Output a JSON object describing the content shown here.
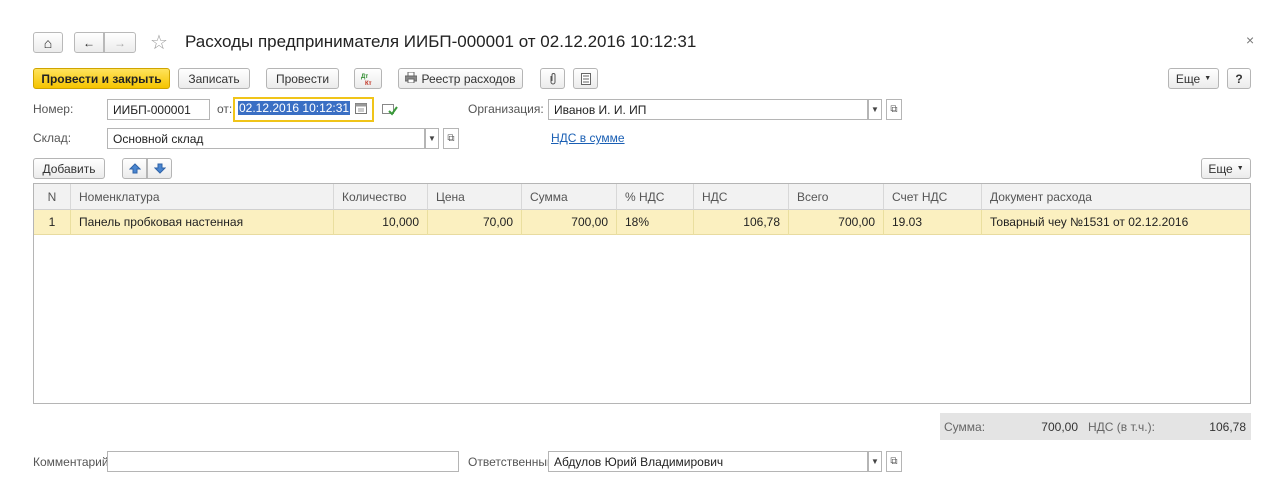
{
  "window": {
    "title": "Расходы предпринимателя ИИБП-000001 от 02.12.2016 10:12:31",
    "close_glyph": "×",
    "home_glyph": "⌂",
    "back_glyph": "←",
    "forward_glyph": "→",
    "star_glyph": "☆"
  },
  "toolbar": {
    "post_close": "Провести и закрыть",
    "save": "Записать",
    "post": "Провести",
    "registry": "Реестр расходов",
    "more": "Еще",
    "help": "?"
  },
  "header": {
    "number_label": "Номер:",
    "number_value": "ИИБП-000001",
    "date_label": "от:",
    "date_value": "02.12.2016 10:12:31",
    "org_label": "Организация:",
    "org_value": "Иванов И. И. ИП",
    "warehouse_label": "Склад:",
    "warehouse_value": "Основной склад",
    "vat_link": "НДС в сумме"
  },
  "table_toolbar": {
    "add": "Добавить",
    "more": "Еще"
  },
  "table": {
    "columns": [
      "N",
      "Номенклатура",
      "Количество",
      "Цена",
      "Сумма",
      "% НДС",
      "НДС",
      "Всего",
      "Счет НДС",
      "Документ расхода"
    ],
    "rows": [
      [
        "1",
        "Панель пробковая настенная",
        "10,000",
        "70,00",
        "700,00",
        "18%",
        "106,78",
        "700,00",
        "19.03",
        "Товарный чеу №1531 от 02.12.2016"
      ]
    ]
  },
  "totals": {
    "sum_label": "Сумма:",
    "sum_value": "700,00",
    "vat_label": "НДС (в т.ч.):",
    "vat_value": "106,78"
  },
  "footer": {
    "comment_label": "Комментарий:",
    "comment_value": "",
    "responsible_label": "Ответственный:",
    "responsible_value": "Абдулов Юрий Владимирович"
  },
  "colors": {
    "accent_yellow": "#f5c400",
    "selected_row": "#fbf0c0",
    "link": "#1a5fb4",
    "date_highlight": "#3a6fc4"
  }
}
